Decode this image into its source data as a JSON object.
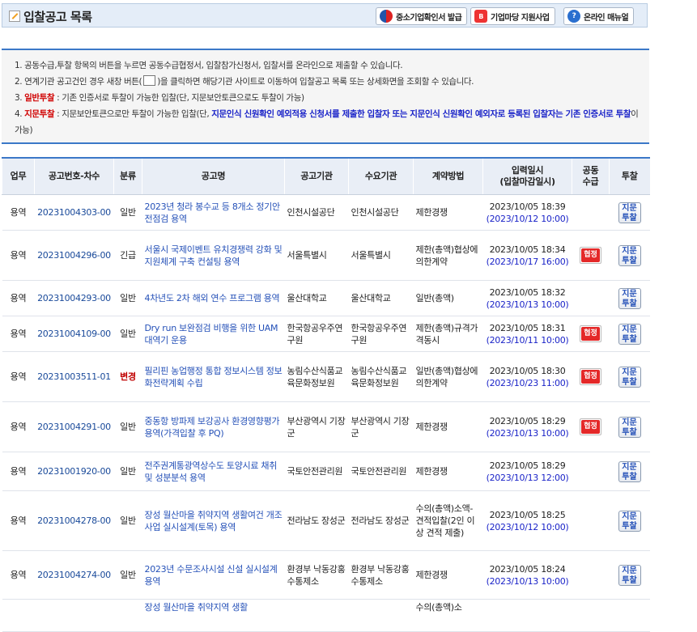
{
  "header": {
    "title": "입찰공고 목록",
    "buttons": [
      {
        "label": "중소기업확인서 발급",
        "icon": "korea-emblem-icon"
      },
      {
        "label": "기업마당 지원사업",
        "icon": "bizinfo-icon"
      },
      {
        "label": "온라인 매뉴얼",
        "icon": "help-icon"
      }
    ]
  },
  "notice": {
    "line1": "1. 공동수급,투찰 항목의 버튼을 누르면 공동수급협정서, 입찰참가신청서, 입찰서를 온라인으로 제출할 수 있습니다.",
    "line2_a": "2. 연계기관 공고건인 경우 새창 버튼(",
    "line2_b": ")을 클릭하면 해당기관 사이트로 이동하여 입찰공고 목록 또는 상세화면을 조회할 수 있습니다.",
    "line3_label": "일반투찰",
    "line3_prefix": "3. ",
    "line3_text": " : 기존 인증서로 투찰이 가능한 입찰(단, 지문보안토큰으로도 투찰이 가능)",
    "line4_prefix": "4. ",
    "line4_label": "지문투찰",
    "line4_text1": " : 지문보안토큰으로만 투찰이 가능한 입찰(단, ",
    "line4_blue": "지문인식 신원확인 예외적용 신청서를 제출한 입찰자 또는 지문인식 신원확인 예외자로 등록된 입찰자는 기존 인증서로 투찰",
    "line4_text2": "이 가능)"
  },
  "table": {
    "headers": [
      "업무",
      "공고번호-차수",
      "분류",
      "공고명",
      "공고기관",
      "수요기관",
      "계약방법",
      "입력일시",
      "(입찰마감일시)",
      "공동",
      "수급",
      "투찰"
    ],
    "bid_button": [
      "지문",
      "투찰"
    ],
    "rows": [
      {
        "biz": "용역",
        "no": "20231004303-00",
        "cls": "일반",
        "title": "2023년 청라 봉수교 등 8개소 정기안전점검 용역",
        "org": "인천시설공단",
        "demand": "인천시설공단",
        "method": "제한경쟁",
        "input": "2023/10/05 18:39",
        "deadline": "(2023/10/12 10:00)",
        "joint": ""
      },
      {
        "biz": "용역",
        "no": "20231004296-00",
        "cls": "긴급",
        "title": "서울시 국제이벤트 유치경쟁력 강화 및 지원체계 구축 컨설팅 용역",
        "org": "서울특별시",
        "demand": "서울특별시",
        "method": "제한(총액)협상에의한계약",
        "input": "2023/10/05 18:34",
        "deadline": "(2023/10/17 16:00)",
        "joint": "협정"
      },
      {
        "biz": "용역",
        "no": "20231004293-00",
        "cls": "일반",
        "title": "4차년도 2차 해외 연수 프로그램 용역",
        "org": "울산대학교",
        "demand": "울산대학교",
        "method": "일반(총액)",
        "input": "2023/10/05 18:32",
        "deadline": "(2023/10/13 10:00)",
        "joint": ""
      },
      {
        "biz": "용역",
        "no": "20231004109-00",
        "cls": "일반",
        "title": "Dry run 보완점검 비행을 위한 UAM 대역기 운용",
        "org": "한국항공우주연구원",
        "demand": "한국항공우주연구원",
        "method": "제한(총액)규격가격동시",
        "input": "2023/10/05 18:31",
        "deadline": "(2023/10/11 10:00)",
        "joint": "협정"
      },
      {
        "biz": "용역",
        "no": "20231003511-01",
        "cls": "변경",
        "title": "필리핀 농업행정 통합 정보시스템 정보화전략계획 수립",
        "org": "농림수산식품교육문화정보원",
        "demand": "농림수산식품교육문화정보원",
        "method": "일반(총액)협상에의한계약",
        "input": "2023/10/05 18:30",
        "deadline": "(2023/10/23 11:00)",
        "joint": "협정"
      },
      {
        "biz": "용역",
        "no": "20231004291-00",
        "cls": "일반",
        "title": "중동항 방파제 보강공사 환경영향평가용역(가격입찰 후 PQ)",
        "org": "부산광역시 기장군",
        "demand": "부산광역시 기장군",
        "method": "제한경쟁",
        "input": "2023/10/05 18:29",
        "deadline": "(2023/10/13 10:00)",
        "joint": "협정"
      },
      {
        "biz": "용역",
        "no": "20231001920-00",
        "cls": "일반",
        "title": "전주권계통광역상수도 토양시료 채취 및 성분분석 용역",
        "org": "국토안전관리원",
        "demand": "국토안전관리원",
        "method": "제한경쟁",
        "input": "2023/10/05 18:29",
        "deadline": "(2023/10/13 12:00)",
        "joint": ""
      },
      {
        "biz": "용역",
        "no": "20231004278-00",
        "cls": "일반",
        "title": "장성 월산마을 취약지역 생활여건 개조사업 실시설계(토목) 용역",
        "org": "전라남도 장성군",
        "demand": "전라남도 장성군",
        "method": "수의(총액)소액-견적입찰(2인 이상 견적 제출)",
        "input": "2023/10/05 18:25",
        "deadline": "(2023/10/12 10:00)",
        "joint": ""
      },
      {
        "biz": "용역",
        "no": "20231004274-00",
        "cls": "일반",
        "title": "2023년 수문조사시설 신설 실시설계용역",
        "org": "환경부 낙동강홍수통제소",
        "demand": "환경부 낙동강홍수통제소",
        "method": "제한경쟁",
        "input": "2023/10/05 18:24",
        "deadline": "(2023/10/13 10:00)",
        "joint": ""
      },
      {
        "biz": "",
        "no": "",
        "cls": "",
        "title": "장성 월산마을 취약지역 생활",
        "org": "",
        "demand": "",
        "method": "수의(총액)소",
        "input": "",
        "deadline": "",
        "joint": ""
      }
    ]
  }
}
